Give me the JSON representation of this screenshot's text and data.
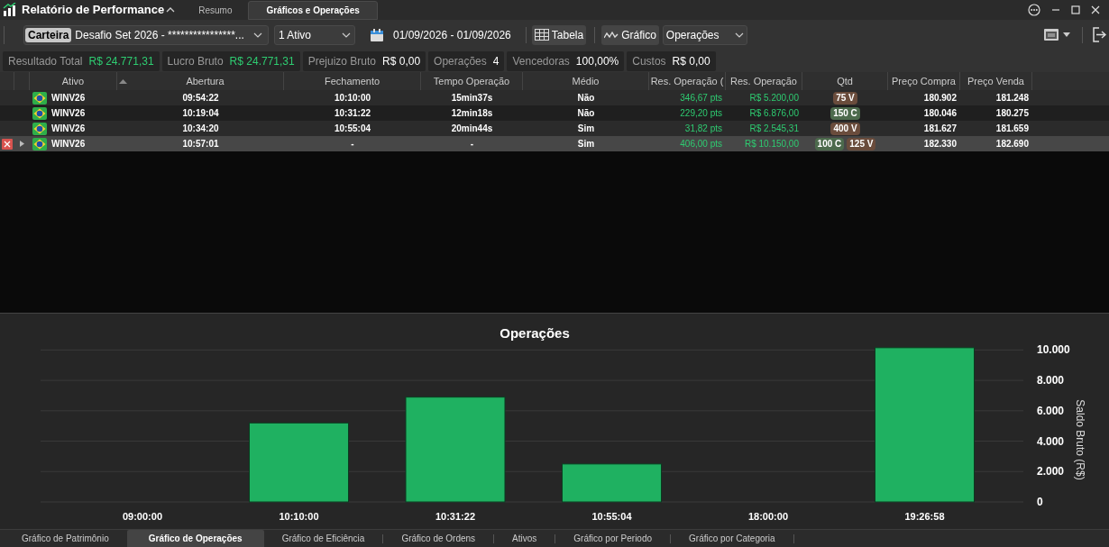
{
  "app": {
    "title": "Relatório de Performance"
  },
  "tabs": [
    {
      "label": "Resumo",
      "selected": false
    },
    {
      "label": "Gráficos e Operações",
      "selected": true
    }
  ],
  "toolbar": {
    "portfolio_tag": "Carteira",
    "portfolio": "Desafio Set 2026 - ****************...",
    "assets": "1 Ativo",
    "date_range": "01/09/2026 - 01/09/2026",
    "table_button": "Tabela",
    "chart_button": "Gráfico",
    "chart_type": "Operações"
  },
  "stats": [
    {
      "label": "Resultado Total",
      "value": "R$ 24.771,31",
      "color": "#2ecc71"
    },
    {
      "label": "Lucro Bruto",
      "value": "R$ 24.771,31",
      "color": "#2ecc71"
    },
    {
      "label": "Prejuizo Bruto",
      "value": "R$ 0,00",
      "color": "#ffffff"
    },
    {
      "label": "Operações",
      "value": "4",
      "color": "#ffffff"
    },
    {
      "label": "Vencedoras",
      "value": "100,00%",
      "color": "#ffffff"
    },
    {
      "label": "Custos",
      "value": "R$ 0,00",
      "color": "#ffffff"
    }
  ],
  "table": {
    "columns": [
      "Ativo",
      "Abertura",
      "Fechamento",
      "Tempo Operação",
      "Médio",
      "Res. Operação (",
      "Res. Operação",
      "Qtd",
      "Preço Compra",
      "Preço Venda"
    ],
    "rows": [
      {
        "selected": false,
        "cells": [
          "WINV26",
          "09:54:22",
          "10:10:00",
          "15min37s",
          "Não",
          "346,67 pts",
          "R$ 5.200,00"
        ],
        "qtd": [
          {
            "text": "75 V",
            "color": "#6a4c3c"
          }
        ],
        "buy": "180.902",
        "sell": "181.248"
      },
      {
        "selected": false,
        "cells": [
          "WINV26",
          "10:19:04",
          "10:31:22",
          "12min18s",
          "Não",
          "229,20 pts",
          "R$ 6.876,00"
        ],
        "qtd": [
          {
            "text": "150 C",
            "color": "#4c6a4c"
          }
        ],
        "buy": "180.046",
        "sell": "180.275"
      },
      {
        "selected": false,
        "cells": [
          "WINV26",
          "10:34:20",
          "10:55:04",
          "20min44s",
          "Sim",
          "31,82 pts",
          "R$ 2.545,31"
        ],
        "qtd": [
          {
            "text": "400 V",
            "color": "#6a4c3c"
          }
        ],
        "buy": "181.627",
        "sell": "181.659"
      },
      {
        "selected": true,
        "cells": [
          "WINV26",
          "10:57:01",
          "-",
          "-",
          "Sim",
          "406,00 pts",
          "R$ 10.150,00"
        ],
        "qtd": [
          {
            "text": "100 C",
            "color": "#4c6a4c"
          },
          {
            "text": "125 V",
            "color": "#6a4c3c"
          }
        ],
        "buy": "182.330",
        "sell": "182.690"
      }
    ]
  },
  "chart_panel": {
    "chart_data": {
      "type": "bar",
      "title": "Operações",
      "ylabel": "Saldo Bruto (R$)",
      "categories": [
        "09:00:00",
        "10:10:00",
        "10:31:22",
        "10:55:04",
        "18:00:00",
        "19:26:58"
      ],
      "series": [
        {
          "color": "#1fb161",
          "values": [
            null,
            5200,
            6900,
            2500,
            null,
            10150
          ]
        }
      ],
      "grid": true,
      "ylim": [
        0,
        10200
      ],
      "yticks": [
        {
          "value": 0,
          "label": "0"
        },
        {
          "value": 2000,
          "label": "2.000"
        },
        {
          "value": 4000,
          "label": "4.000"
        },
        {
          "value": 6000,
          "label": "6.000"
        },
        {
          "value": 8000,
          "label": "8.000"
        },
        {
          "value": 10000,
          "label": "10.000"
        }
      ]
    }
  },
  "bottom_tabs": [
    {
      "label": "Gráfico de Patrimônio",
      "selected": false
    },
    {
      "label": "Gráfico de Operações",
      "selected": true
    },
    {
      "label": "Gráfico de Eficiência",
      "selected": false
    },
    {
      "label": "Gráfico de Ordens",
      "selected": false
    },
    {
      "label": "Ativos",
      "selected": false
    },
    {
      "label": "Gráfico por Periodo",
      "selected": false
    },
    {
      "label": "Gráfico por Categoria",
      "selected": false
    }
  ]
}
